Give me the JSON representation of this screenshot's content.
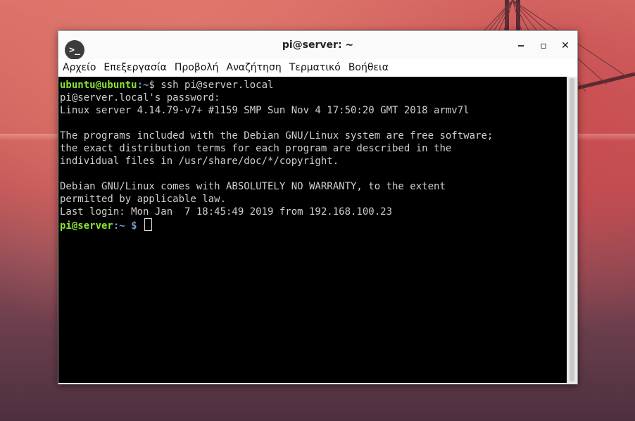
{
  "window": {
    "title": "pi@server: ~",
    "app_icon": "terminal-icon",
    "app_icon_glyph": ">_",
    "minimize_glyph": "‒",
    "maximize_glyph": "▫",
    "close_glyph": "✕"
  },
  "menu": [
    "Αρχείο",
    "Επεξεργασία",
    "Προβολή",
    "Αναζήτηση",
    "Τερματικό",
    "Βοήθεια"
  ],
  "terminal": {
    "local_prompt_user": "ubuntu@ubuntu",
    "local_prompt_path": ":~",
    "local_prompt_symbol": "$",
    "command": " ssh pi@server.local",
    "lines": [
      "pi@server.local's password:",
      "Linux server 4.14.79-v7+ #1159 SMP Sun Nov 4 17:50:20 GMT 2018 armv7l",
      "",
      "The programs included with the Debian GNU/Linux system are free software;",
      "the exact distribution terms for each program are described in the",
      "individual files in /usr/share/doc/*/copyright.",
      "",
      "Debian GNU/Linux comes with ABSOLUTELY NO WARRANTY, to the extent",
      "permitted by applicable law.",
      "Last login: Mon Jan  7 18:45:49 2019 from 192.168.100.23"
    ],
    "remote_prompt_user": "pi@server",
    "remote_prompt_path": ":~ $"
  },
  "colors": {
    "prompt_user": "#8ae234",
    "prompt_path": "#729fcf",
    "terminal_bg": "#000000",
    "terminal_fg": "#cfcfcf"
  }
}
